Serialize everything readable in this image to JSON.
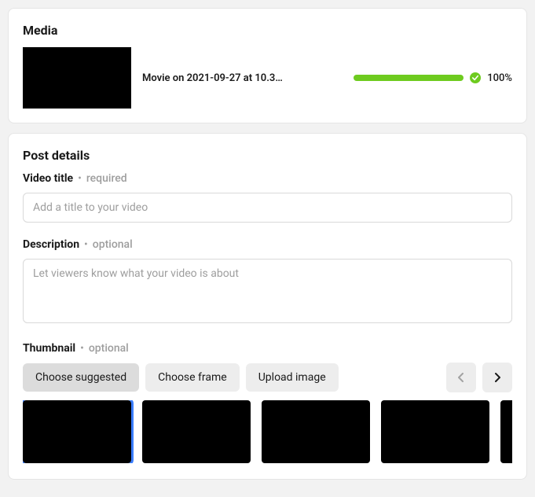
{
  "media": {
    "section_title": "Media",
    "file_name": "Movie on 2021-09-27 at 10.3…",
    "progress_label": "100%"
  },
  "post_details": {
    "section_title": "Post details",
    "title_field": {
      "label": "Video title",
      "req": "required",
      "placeholder": "Add a title to your video",
      "value": ""
    },
    "desc_field": {
      "label": "Description",
      "req": "optional",
      "placeholder": "Let viewers know what your video is about",
      "value": ""
    },
    "thumb_field": {
      "label": "Thumbnail",
      "req": "optional",
      "btn_suggested": "Choose suggested",
      "btn_frame": "Choose frame",
      "btn_upload": "Upload image"
    }
  }
}
